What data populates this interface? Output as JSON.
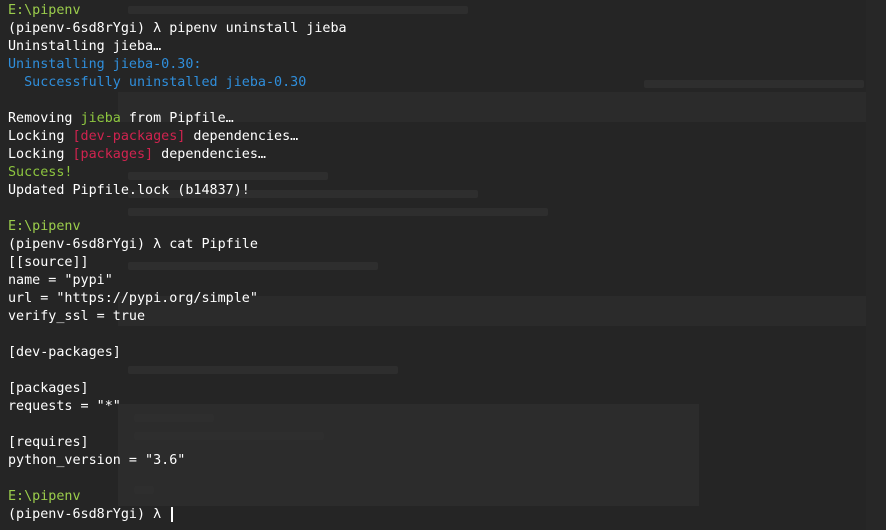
{
  "colors": {
    "background": "#252525",
    "text": "#ffffff",
    "prompt_path": "#9bcd4c",
    "info_blue": "#2f8edb",
    "success_green": "#8dc63f",
    "section_red": "#d0234f"
  },
  "session": [
    {
      "type": "prompt_path",
      "text": "E:\\pipenv"
    },
    {
      "type": "command",
      "env": "(pipenv-6sd8rYgi)",
      "symbol": "λ",
      "cmd": "pipenv uninstall jieba"
    },
    {
      "type": "output",
      "text": "Uninstalling jieba…"
    },
    {
      "type": "output_blue",
      "text": "Uninstalling jieba-0.30:"
    },
    {
      "type": "output_blue_indent",
      "text": "  Successfully uninstalled jieba-0.30"
    },
    {
      "type": "blank"
    },
    {
      "type": "removing",
      "pre": "Removing ",
      "pkg": "jieba",
      "post": " from Pipfile…"
    },
    {
      "type": "locking",
      "pre": "Locking ",
      "tag": "[dev-packages]",
      "post": " dependencies…"
    },
    {
      "type": "locking",
      "pre": "Locking ",
      "tag": "[packages]",
      "post": " dependencies…"
    },
    {
      "type": "success",
      "text": "Success!"
    },
    {
      "type": "output",
      "text": "Updated Pipfile.lock (b14837)!"
    },
    {
      "type": "blank"
    },
    {
      "type": "prompt_path",
      "text": "E:\\pipenv"
    },
    {
      "type": "command",
      "env": "(pipenv-6sd8rYgi)",
      "symbol": "λ",
      "cmd": "cat Pipfile"
    },
    {
      "type": "output",
      "text": "[[source]]"
    },
    {
      "type": "output",
      "text": "name = \"pypi\""
    },
    {
      "type": "output",
      "text": "url = \"https://pypi.org/simple\""
    },
    {
      "type": "output",
      "text": "verify_ssl = true"
    },
    {
      "type": "blank"
    },
    {
      "type": "output",
      "text": "[dev-packages]"
    },
    {
      "type": "blank"
    },
    {
      "type": "output",
      "text": "[packages]"
    },
    {
      "type": "output",
      "text": "requests = \"*\""
    },
    {
      "type": "blank"
    },
    {
      "type": "output",
      "text": "[requires]"
    },
    {
      "type": "output",
      "text": "python_version = \"3.6\""
    },
    {
      "type": "blank"
    },
    {
      "type": "prompt_path",
      "text": "E:\\pipenv"
    },
    {
      "type": "active_prompt",
      "env": "(pipenv-6sd8rYgi)",
      "symbol": "λ"
    }
  ]
}
